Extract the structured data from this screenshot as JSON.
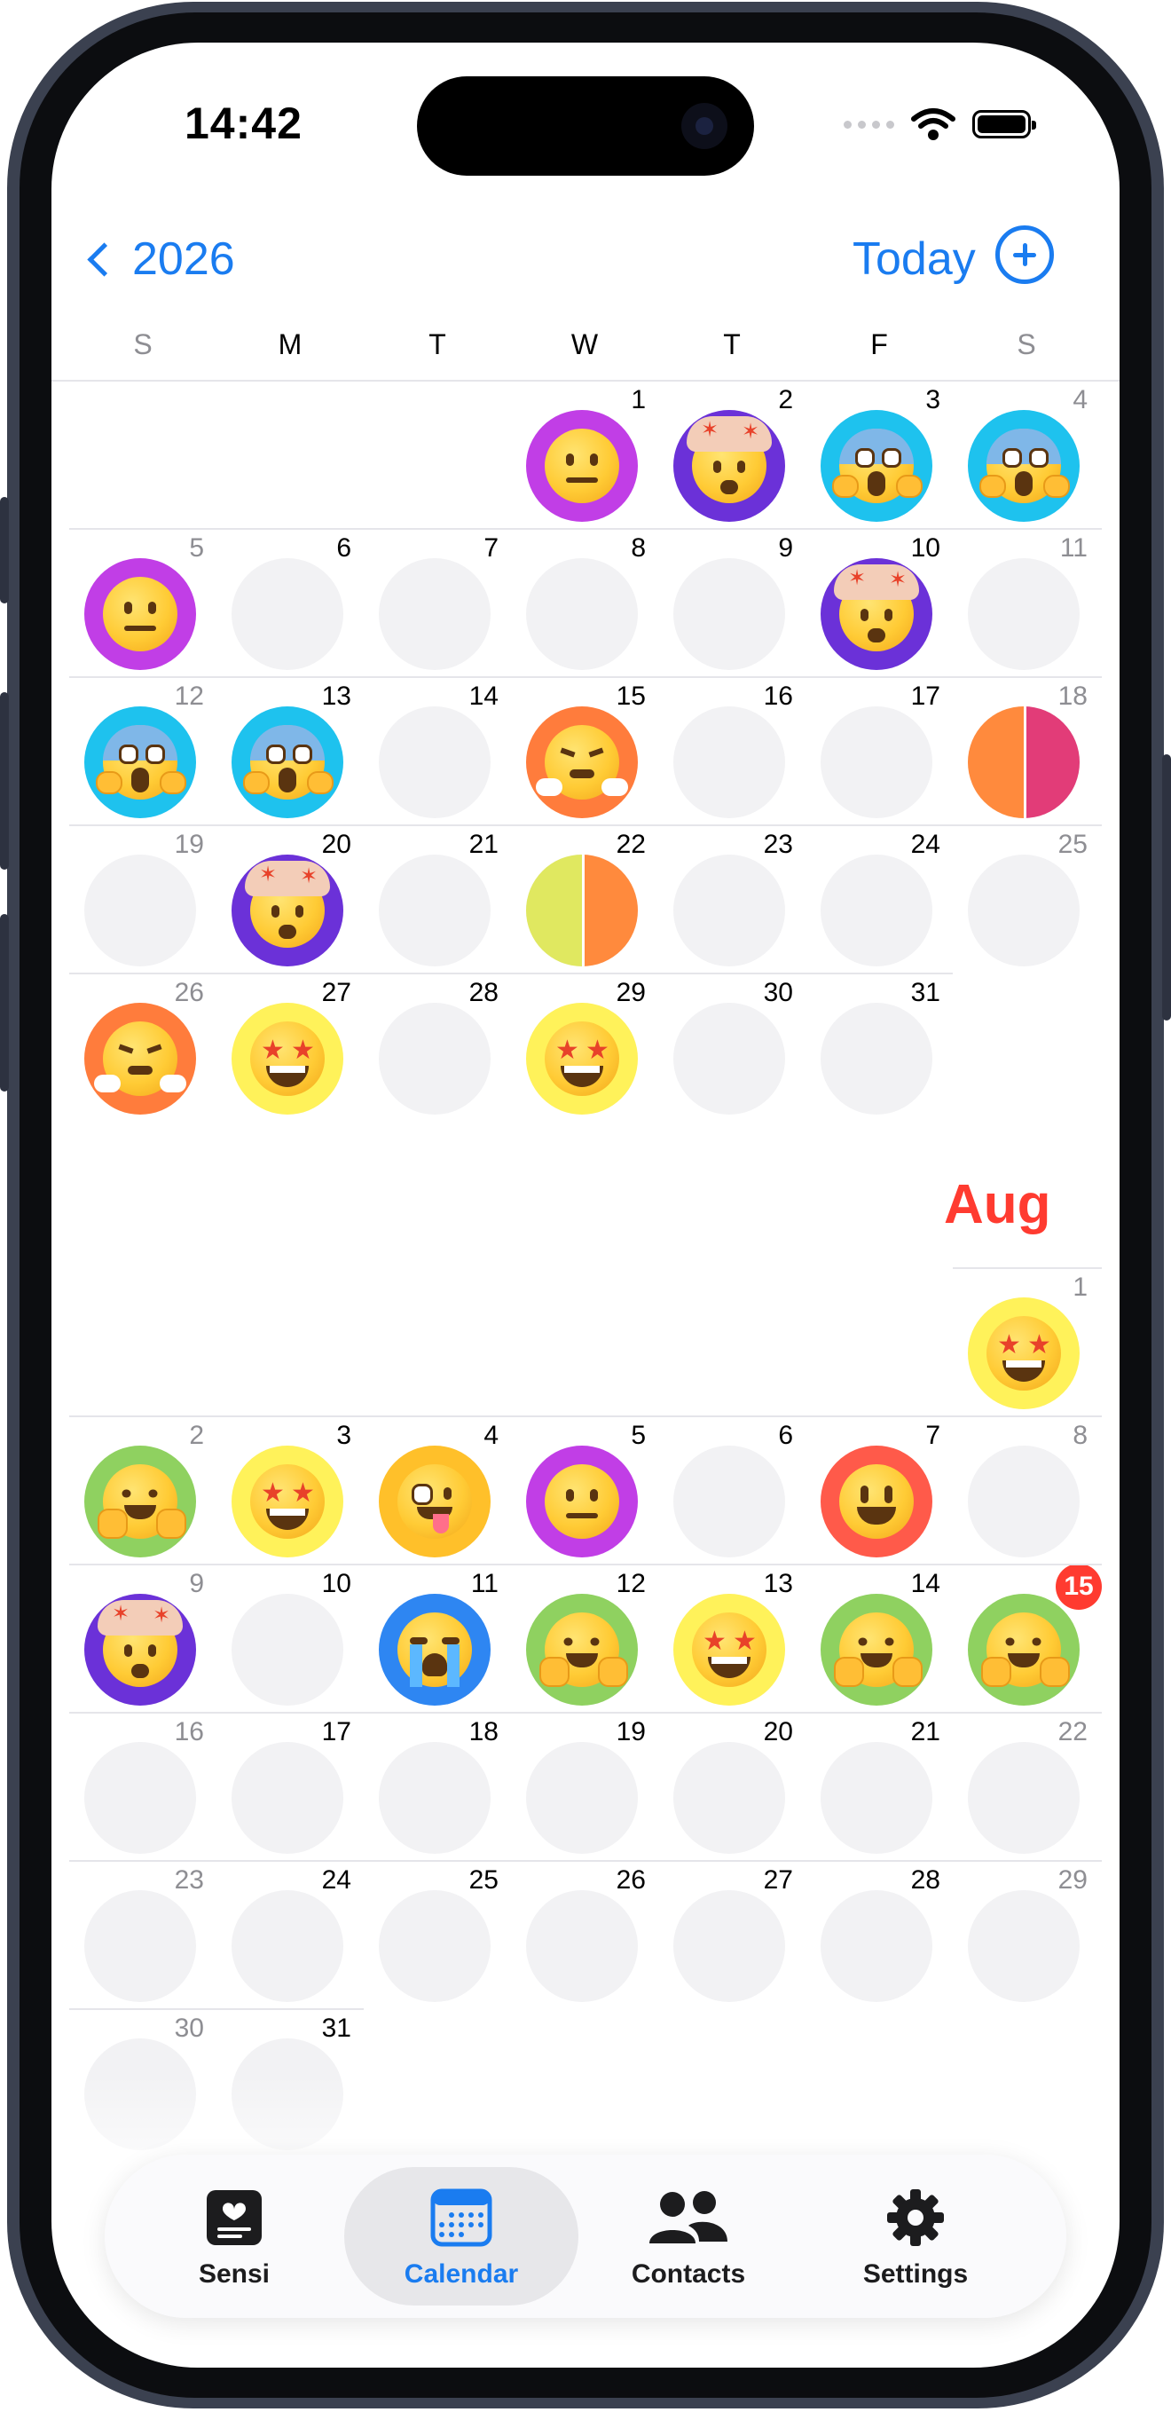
{
  "status_bar": {
    "time": "14:42"
  },
  "nav": {
    "back_label": "2026",
    "today_label": "Today"
  },
  "weekdays": [
    "S",
    "M",
    "T",
    "W",
    "T",
    "F",
    "S"
  ],
  "july": {
    "days": [
      {
        "d": "1",
        "mood": "neutral",
        "color": "#c13ee6"
      },
      {
        "d": "2",
        "mood": "exploding",
        "color": "#6b31d8"
      },
      {
        "d": "3",
        "mood": "scream",
        "color": "#1ec2ee"
      },
      {
        "d": "4",
        "mood": "scream",
        "color": "#1ec2ee"
      },
      {
        "d": "5",
        "mood": "neutral",
        "color": "#c13ee6"
      },
      {
        "d": "6"
      },
      {
        "d": "7"
      },
      {
        "d": "8"
      },
      {
        "d": "9"
      },
      {
        "d": "10",
        "mood": "exploding",
        "color": "#6b31d8"
      },
      {
        "d": "11"
      },
      {
        "d": "12",
        "mood": "scream",
        "color": "#1ec2ee"
      },
      {
        "d": "13",
        "mood": "scream",
        "color": "#1ec2ee"
      },
      {
        "d": "14"
      },
      {
        "d": "15",
        "mood": "steam",
        "color": "#ff7c3c"
      },
      {
        "d": "16"
      },
      {
        "d": "17"
      },
      {
        "d": "18",
        "split": [
          "#ff8a3d",
          "#e23c78"
        ]
      },
      {
        "d": "19"
      },
      {
        "d": "20",
        "mood": "exploding",
        "color": "#6b31d8"
      },
      {
        "d": "21"
      },
      {
        "d": "22",
        "split": [
          "#e0e860",
          "#ff8a3d"
        ]
      },
      {
        "d": "23"
      },
      {
        "d": "24"
      },
      {
        "d": "25"
      },
      {
        "d": "26",
        "mood": "steam",
        "color": "#ff7c3c"
      },
      {
        "d": "27",
        "mood": "starstruck",
        "color": "#fff25a"
      },
      {
        "d": "28"
      },
      {
        "d": "29",
        "mood": "starstruck",
        "color": "#fff25a"
      },
      {
        "d": "30"
      },
      {
        "d": "31"
      }
    ]
  },
  "august": {
    "label": "Aug",
    "today_badge": "15",
    "days": [
      {
        "d": "1",
        "mood": "starstruck",
        "color": "#fff25a"
      },
      {
        "d": "2",
        "mood": "hug",
        "color": "#8fd160"
      },
      {
        "d": "3",
        "mood": "starstruck",
        "color": "#fff25a"
      },
      {
        "d": "4",
        "mood": "zany",
        "color": "#ffc02a"
      },
      {
        "d": "5",
        "mood": "neutral",
        "color": "#c13ee6"
      },
      {
        "d": "6"
      },
      {
        "d": "7",
        "mood": "smile",
        "color": "#ff5a4a"
      },
      {
        "d": "8"
      },
      {
        "d": "9",
        "mood": "exploding",
        "color": "#6b31d8"
      },
      {
        "d": "10"
      },
      {
        "d": "11",
        "mood": "cry",
        "color": "#2e86f2"
      },
      {
        "d": "12",
        "mood": "hug",
        "color": "#8fd160"
      },
      {
        "d": "13",
        "mood": "starstruck",
        "color": "#fff25a"
      },
      {
        "d": "14",
        "mood": "hug",
        "color": "#8fd160"
      },
      {
        "d": "15",
        "mood": "hug",
        "color": "#8fd160",
        "today": true
      },
      {
        "d": "16"
      },
      {
        "d": "17"
      },
      {
        "d": "18"
      },
      {
        "d": "19"
      },
      {
        "d": "20"
      },
      {
        "d": "21"
      },
      {
        "d": "22"
      },
      {
        "d": "23"
      },
      {
        "d": "24"
      },
      {
        "d": "25"
      },
      {
        "d": "26"
      },
      {
        "d": "27"
      },
      {
        "d": "28"
      },
      {
        "d": "29"
      },
      {
        "d": "30"
      },
      {
        "d": "31"
      }
    ]
  },
  "tabs": [
    {
      "label": "Sensi",
      "icon": "journal-icon",
      "active": false
    },
    {
      "label": "Calendar",
      "icon": "calendar-icon",
      "active": true
    },
    {
      "label": "Contacts",
      "icon": "people-icon",
      "active": false
    },
    {
      "label": "Settings",
      "icon": "gear-icon",
      "active": false
    }
  ],
  "colors": {
    "accent": "#1a7cf0",
    "month_label": "#ff3b30",
    "empty_day": "#f2f2f4"
  }
}
